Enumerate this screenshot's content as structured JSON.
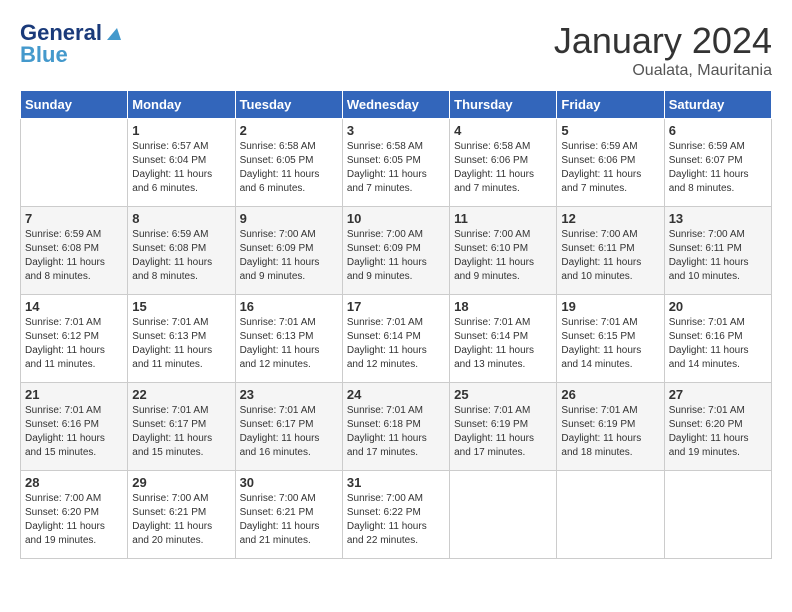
{
  "logo": {
    "text1": "General",
    "text2": "Blue"
  },
  "title": "January 2024",
  "location": "Oualata, Mauritania",
  "weekdays": [
    "Sunday",
    "Monday",
    "Tuesday",
    "Wednesday",
    "Thursday",
    "Friday",
    "Saturday"
  ],
  "weeks": [
    [
      {
        "day": "",
        "info": ""
      },
      {
        "day": "1",
        "info": "Sunrise: 6:57 AM\nSunset: 6:04 PM\nDaylight: 11 hours\nand 6 minutes."
      },
      {
        "day": "2",
        "info": "Sunrise: 6:58 AM\nSunset: 6:05 PM\nDaylight: 11 hours\nand 6 minutes."
      },
      {
        "day": "3",
        "info": "Sunrise: 6:58 AM\nSunset: 6:05 PM\nDaylight: 11 hours\nand 7 minutes."
      },
      {
        "day": "4",
        "info": "Sunrise: 6:58 AM\nSunset: 6:06 PM\nDaylight: 11 hours\nand 7 minutes."
      },
      {
        "day": "5",
        "info": "Sunrise: 6:59 AM\nSunset: 6:06 PM\nDaylight: 11 hours\nand 7 minutes."
      },
      {
        "day": "6",
        "info": "Sunrise: 6:59 AM\nSunset: 6:07 PM\nDaylight: 11 hours\nand 8 minutes."
      }
    ],
    [
      {
        "day": "7",
        "info": "Sunrise: 6:59 AM\nSunset: 6:08 PM\nDaylight: 11 hours\nand 8 minutes."
      },
      {
        "day": "8",
        "info": "Sunrise: 6:59 AM\nSunset: 6:08 PM\nDaylight: 11 hours\nand 8 minutes."
      },
      {
        "day": "9",
        "info": "Sunrise: 7:00 AM\nSunset: 6:09 PM\nDaylight: 11 hours\nand 9 minutes."
      },
      {
        "day": "10",
        "info": "Sunrise: 7:00 AM\nSunset: 6:09 PM\nDaylight: 11 hours\nand 9 minutes."
      },
      {
        "day": "11",
        "info": "Sunrise: 7:00 AM\nSunset: 6:10 PM\nDaylight: 11 hours\nand 9 minutes."
      },
      {
        "day": "12",
        "info": "Sunrise: 7:00 AM\nSunset: 6:11 PM\nDaylight: 11 hours\nand 10 minutes."
      },
      {
        "day": "13",
        "info": "Sunrise: 7:00 AM\nSunset: 6:11 PM\nDaylight: 11 hours\nand 10 minutes."
      }
    ],
    [
      {
        "day": "14",
        "info": "Sunrise: 7:01 AM\nSunset: 6:12 PM\nDaylight: 11 hours\nand 11 minutes."
      },
      {
        "day": "15",
        "info": "Sunrise: 7:01 AM\nSunset: 6:13 PM\nDaylight: 11 hours\nand 11 minutes."
      },
      {
        "day": "16",
        "info": "Sunrise: 7:01 AM\nSunset: 6:13 PM\nDaylight: 11 hours\nand 12 minutes."
      },
      {
        "day": "17",
        "info": "Sunrise: 7:01 AM\nSunset: 6:14 PM\nDaylight: 11 hours\nand 12 minutes."
      },
      {
        "day": "18",
        "info": "Sunrise: 7:01 AM\nSunset: 6:14 PM\nDaylight: 11 hours\nand 13 minutes."
      },
      {
        "day": "19",
        "info": "Sunrise: 7:01 AM\nSunset: 6:15 PM\nDaylight: 11 hours\nand 14 minutes."
      },
      {
        "day": "20",
        "info": "Sunrise: 7:01 AM\nSunset: 6:16 PM\nDaylight: 11 hours\nand 14 minutes."
      }
    ],
    [
      {
        "day": "21",
        "info": "Sunrise: 7:01 AM\nSunset: 6:16 PM\nDaylight: 11 hours\nand 15 minutes."
      },
      {
        "day": "22",
        "info": "Sunrise: 7:01 AM\nSunset: 6:17 PM\nDaylight: 11 hours\nand 15 minutes."
      },
      {
        "day": "23",
        "info": "Sunrise: 7:01 AM\nSunset: 6:17 PM\nDaylight: 11 hours\nand 16 minutes."
      },
      {
        "day": "24",
        "info": "Sunrise: 7:01 AM\nSunset: 6:18 PM\nDaylight: 11 hours\nand 17 minutes."
      },
      {
        "day": "25",
        "info": "Sunrise: 7:01 AM\nSunset: 6:19 PM\nDaylight: 11 hours\nand 17 minutes."
      },
      {
        "day": "26",
        "info": "Sunrise: 7:01 AM\nSunset: 6:19 PM\nDaylight: 11 hours\nand 18 minutes."
      },
      {
        "day": "27",
        "info": "Sunrise: 7:01 AM\nSunset: 6:20 PM\nDaylight: 11 hours\nand 19 minutes."
      }
    ],
    [
      {
        "day": "28",
        "info": "Sunrise: 7:00 AM\nSunset: 6:20 PM\nDaylight: 11 hours\nand 19 minutes."
      },
      {
        "day": "29",
        "info": "Sunrise: 7:00 AM\nSunset: 6:21 PM\nDaylight: 11 hours\nand 20 minutes."
      },
      {
        "day": "30",
        "info": "Sunrise: 7:00 AM\nSunset: 6:21 PM\nDaylight: 11 hours\nand 21 minutes."
      },
      {
        "day": "31",
        "info": "Sunrise: 7:00 AM\nSunset: 6:22 PM\nDaylight: 11 hours\nand 22 minutes."
      },
      {
        "day": "",
        "info": ""
      },
      {
        "day": "",
        "info": ""
      },
      {
        "day": "",
        "info": ""
      }
    ]
  ]
}
